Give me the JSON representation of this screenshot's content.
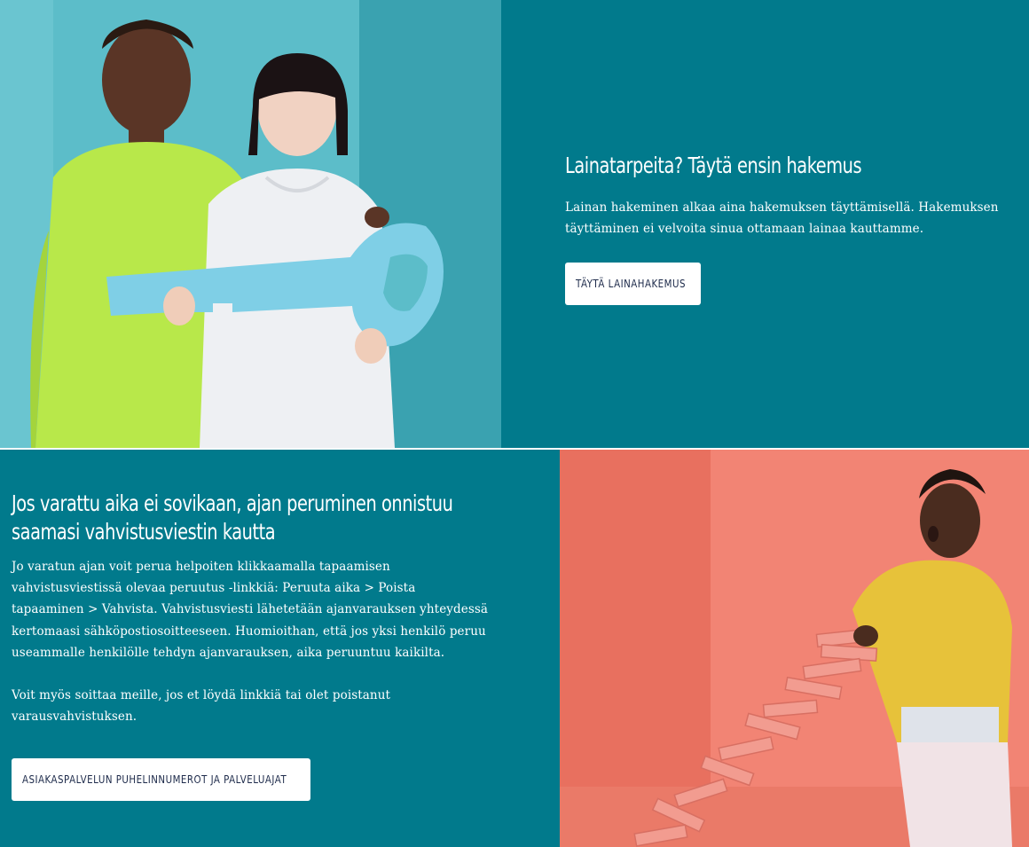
{
  "top_section": {
    "heading": "Lainatarpeita? Täytä ensin hakemus",
    "body": "Lainan hakeminen alkaa aina hakemuksen täyttämisellä. Hakemuksen täyttäminen ei velvoita sinua ottamaan lainaa kauttamme.",
    "button_label": "TÄYTÄ LAINAHAKEMUS"
  },
  "bottom_section": {
    "heading": "Jos varattu aika ei sovikaan, ajan peruminen onnistuu saamasi vahvistusviestin kautta",
    "body_1": "Jo varatun ajan voit perua helpoiten klikkaamalla tapaamisen vahvistusviestissä olevaa peruutus -linkkiä: Peruuta aika > Poista tapaaminen > Vahvista. Vahvistusviesti lähetetään ajanvarauksen yhteydessä kertomaasi sähköpostiosoitteeseen. Huomioithan, että jos yksi henkilö peruu useammalle henkilölle tehdyn ajanvarauksen, aika peruuntuu kaikilta.",
    "body_2": "Voit myös soittaa meille, jos et löydä linkkiä tai olet poistanut varausvahvistuksen.",
    "button_label": "ASIAKASPALVELUN PUHELINNUMEROT JA PALVELUAJAT"
  },
  "colors": {
    "section_bg": "#017a8c",
    "button_bg": "#ffffff",
    "button_text": "#1d2a4a",
    "key_photo_bg": "#4fb5c3",
    "books_photo_bg": "#f07a6a"
  }
}
